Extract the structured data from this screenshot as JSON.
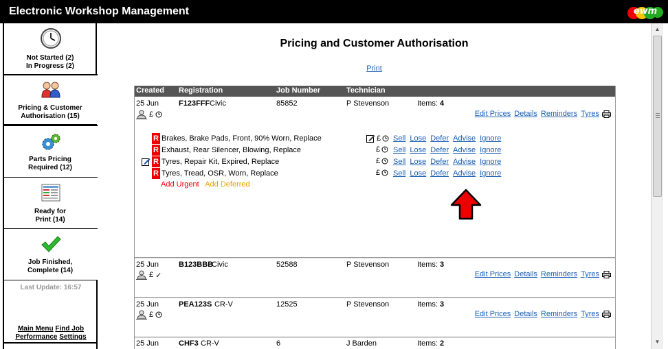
{
  "app": {
    "title": "Electronic Workshop Management",
    "logo_text": "ewm"
  },
  "sidebar": {
    "items": [
      {
        "line1": "Not Started (2)",
        "line2": "In Progress (2)",
        "icon": "clock-icon"
      },
      {
        "line1": "Pricing & Customer",
        "line2": "Authorisation (15)",
        "icon": "people-icon"
      },
      {
        "line1": "Parts Pricing",
        "line2": "Required (12)",
        "icon": "gears-icon"
      },
      {
        "line1": "Ready for",
        "line2": "Print (14)",
        "icon": "document-icon"
      },
      {
        "line1": "Job Finished,",
        "line2": "Complete (14)",
        "icon": "checkmark-icon"
      }
    ],
    "last_update": "Last Update: 16:57",
    "links": {
      "main_menu": "Main Menu",
      "find_job": "Find Job",
      "performance": "Performance",
      "settings": "Settings"
    }
  },
  "main": {
    "title": "Pricing and Customer Authorisation",
    "print": "Print",
    "columns": [
      "Created",
      "Registration",
      "Job Number",
      "Technician"
    ],
    "job_links": {
      "edit_prices": "Edit Prices",
      "details": "Details",
      "reminders": "Reminders",
      "tyres": "Tyres"
    },
    "jobs": [
      {
        "created": "25 Jun",
        "reg": "F123FFF",
        "model": "Civic",
        "job_number": "85852",
        "technician": "P Stevenson",
        "items_label": "Items:",
        "items_count": "4"
      },
      {
        "created": "25 Jun",
        "reg": "B123BBB",
        "model": "Civic",
        "job_number": "52588",
        "technician": "P Stevenson",
        "items_label": "Items:",
        "items_count": "3"
      },
      {
        "created": "25 Jun",
        "reg": "PEA123S",
        "model": "CR-V",
        "job_number": "12525",
        "technician": "P Stevenson",
        "items_label": "Items:",
        "items_count": "3"
      },
      {
        "created": "25 Jun",
        "reg": "CHF3",
        "model": "CR-V",
        "job_number": "6",
        "technician": "J Barden",
        "items_label": "Items:",
        "items_count": "2"
      }
    ],
    "work_items": [
      {
        "badge": "R",
        "desc": "Brakes, Brake Pads, Front, 90% Worn, Replace"
      },
      {
        "badge": "R",
        "desc": "Exhaust, Rear Silencer, Blowing, Replace"
      },
      {
        "badge": "R",
        "desc": "Tyres, Repair Kit, Expired, Replace"
      },
      {
        "badge": "R",
        "desc": "Tyres, Tread, OSR, Worn, Replace"
      }
    ],
    "item_actions": {
      "pound": "£",
      "sell": "Sell",
      "lose": "Lose",
      "defer": "Defer",
      "advise": "Advise",
      "ignore": "Ignore"
    },
    "add_urgent": "Add Urgent",
    "add_deferred": "Add Deferred",
    "pound": "£",
    "tick": "✓"
  },
  "colors": {
    "titlebar": "#000000",
    "header_row": "#555555",
    "link": "#1a5fb4",
    "urgent": "#ee0000",
    "deferred": "#e6a000",
    "arrow": "#ee0000"
  }
}
